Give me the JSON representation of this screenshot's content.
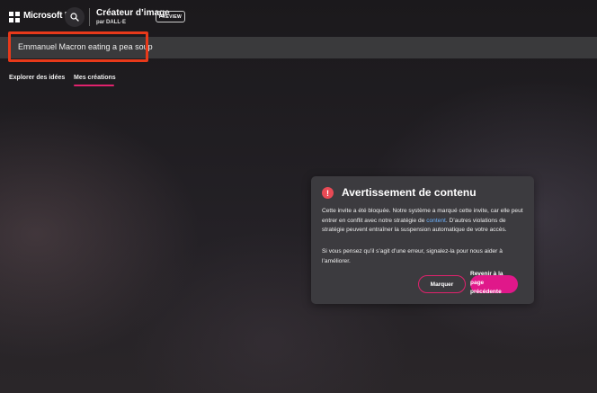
{
  "header": {
    "brand": "Microsoft Bing",
    "title": "Créateur d’image",
    "subtitle": "par DALL·E",
    "preview_badge": "PREVIEW",
    "search_icon": "search-icon"
  },
  "prompt": {
    "text": "Emmanuel Macron eating a pea soup",
    "highlight_color": "#e8391a"
  },
  "tabs": [
    {
      "label": "Explorer des idées",
      "active": false
    },
    {
      "label": "Mes créations",
      "active": true
    }
  ],
  "dialog": {
    "icon": "exclamation-icon",
    "title": "Avertissement de contenu",
    "body_before_link": "Cette invite a été bloquée. Notre système a marqué cette invite, car elle peut entrer en conflit avec notre stratégie de ",
    "link_text": "content",
    "body_after_link": ". D’autres violations de stratégie peuvent entraîner la suspension automatique de votre accès.",
    "body2": "Si vous pensez qu’il s’agit d’une erreur, signalez-la pour nous aider à l’améliorer.",
    "mark_button": "Marquer",
    "back_button": "Revenir à la page précédente"
  },
  "colors": {
    "accent": "#e0226d",
    "back_button_bg": "#e0188a",
    "warning_icon": "#e84a55",
    "link": "#6eb3ff",
    "dialog_bg": "#3c3b3f"
  }
}
